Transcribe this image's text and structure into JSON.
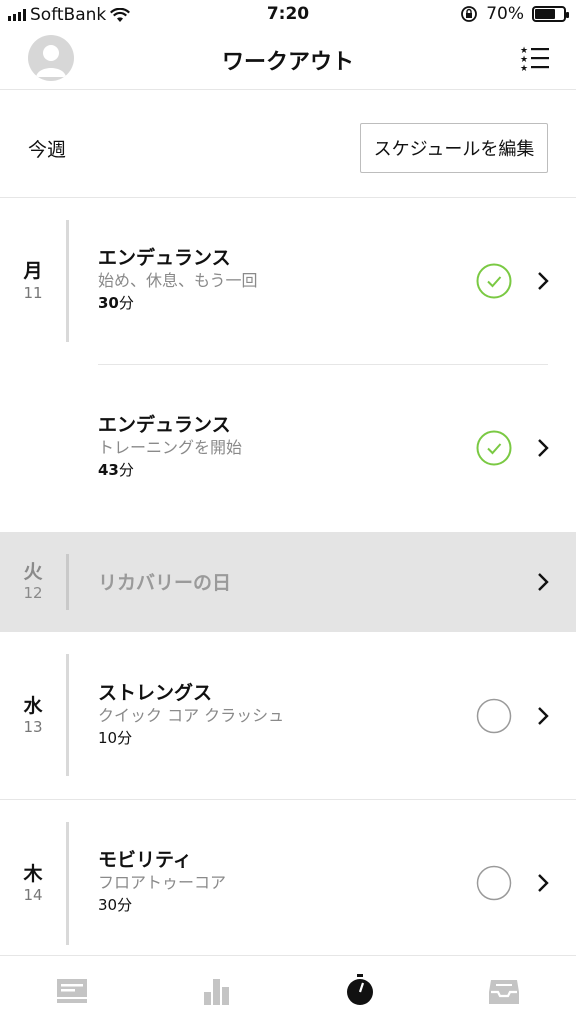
{
  "status_bar": {
    "carrier": "SoftBank",
    "time": "7:20",
    "battery": "70%",
    "battery_level": 0.7
  },
  "nav": {
    "title": "ワークアウト"
  },
  "week": {
    "label": "今週",
    "edit_button": "スケジュールを編集"
  },
  "days": [
    {
      "dow": "月",
      "date": "11",
      "workouts": [
        {
          "name": "エンデュランス",
          "subtitle": "始め、休息、もう一回",
          "duration_value": "30",
          "duration_unit": "分",
          "completed": true
        },
        {
          "name": "エンデュランス",
          "subtitle": "トレーニングを開始",
          "duration_value": "43",
          "duration_unit": "分",
          "completed": true
        }
      ]
    },
    {
      "dow": "火",
      "date": "12",
      "rest_label": "リカバリーの日"
    },
    {
      "dow": "水",
      "date": "13",
      "workouts": [
        {
          "name": "ストレングス",
          "subtitle": "クイック コア クラッシュ",
          "duration": "10分",
          "completed": false
        }
      ]
    },
    {
      "dow": "木",
      "date": "14",
      "workouts": [
        {
          "name": "モビリティ",
          "subtitle": "フロアトゥーコア",
          "duration": "30分",
          "completed": false
        }
      ]
    }
  ],
  "tabs": [
    {
      "icon": "feed-icon",
      "active": false
    },
    {
      "icon": "activity-chart-icon",
      "active": false
    },
    {
      "icon": "stopwatch-icon",
      "active": true
    },
    {
      "icon": "inbox-icon",
      "active": false
    }
  ],
  "colors": {
    "check_green": "#7ac943",
    "rest_bg": "#e4e4e4",
    "divider": "#e6e6e6"
  }
}
